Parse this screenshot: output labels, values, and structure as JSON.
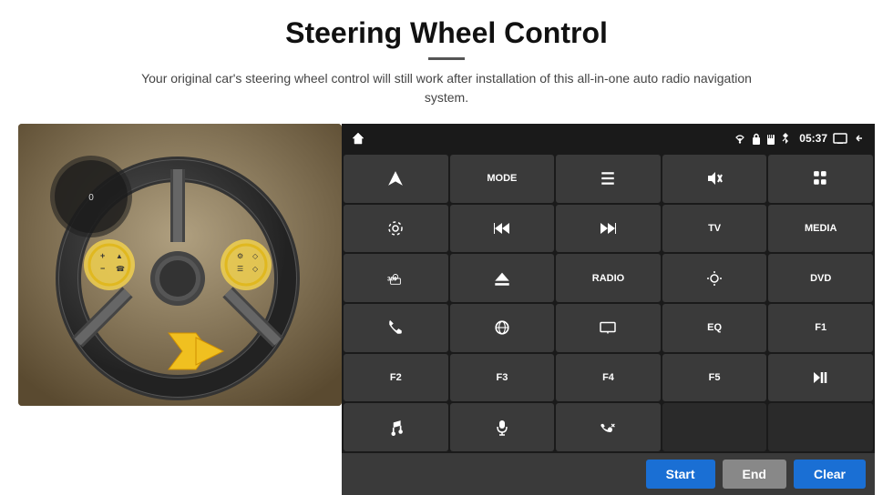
{
  "header": {
    "title": "Steering Wheel Control",
    "subtitle": "Your original car's steering wheel control will still work after installation of this all-in-one auto radio navigation system."
  },
  "statusBar": {
    "time": "05:37",
    "icons": [
      "home",
      "wifi",
      "lock",
      "sd",
      "bluetooth",
      "screen",
      "back"
    ]
  },
  "gridButtons": [
    {
      "id": "r0c0",
      "type": "icon",
      "icon": "navigate",
      "label": ""
    },
    {
      "id": "r0c1",
      "type": "text",
      "label": "MODE"
    },
    {
      "id": "r0c2",
      "type": "icon",
      "icon": "list",
      "label": ""
    },
    {
      "id": "r0c3",
      "type": "icon",
      "icon": "mute",
      "label": ""
    },
    {
      "id": "r0c4",
      "type": "icon",
      "icon": "apps",
      "label": ""
    },
    {
      "id": "r1c0",
      "type": "icon",
      "icon": "settings-o",
      "label": ""
    },
    {
      "id": "r1c1",
      "type": "icon",
      "icon": "rewind",
      "label": ""
    },
    {
      "id": "r1c2",
      "type": "icon",
      "icon": "fastforward",
      "label": ""
    },
    {
      "id": "r1c3",
      "type": "text",
      "label": "TV"
    },
    {
      "id": "r1c4",
      "type": "text",
      "label": "MEDIA"
    },
    {
      "id": "r2c0",
      "type": "icon",
      "icon": "360-cam",
      "label": ""
    },
    {
      "id": "r2c1",
      "type": "icon",
      "icon": "eject",
      "label": ""
    },
    {
      "id": "r2c2",
      "type": "text",
      "label": "RADIO"
    },
    {
      "id": "r2c3",
      "type": "icon",
      "icon": "brightness",
      "label": ""
    },
    {
      "id": "r2c4",
      "type": "text",
      "label": "DVD"
    },
    {
      "id": "r3c0",
      "type": "icon",
      "icon": "phone",
      "label": ""
    },
    {
      "id": "r3c1",
      "type": "icon",
      "icon": "browse",
      "label": ""
    },
    {
      "id": "r3c2",
      "type": "icon",
      "icon": "display",
      "label": ""
    },
    {
      "id": "r3c3",
      "type": "text",
      "label": "EQ"
    },
    {
      "id": "r3c4",
      "type": "text",
      "label": "F1"
    },
    {
      "id": "r4c0",
      "type": "text",
      "label": "F2"
    },
    {
      "id": "r4c1",
      "type": "text",
      "label": "F3"
    },
    {
      "id": "r4c2",
      "type": "text",
      "label": "F4"
    },
    {
      "id": "r4c3",
      "type": "text",
      "label": "F5"
    },
    {
      "id": "r4c4",
      "type": "icon",
      "icon": "playpause",
      "label": ""
    },
    {
      "id": "r5c0",
      "type": "icon",
      "icon": "music",
      "label": ""
    },
    {
      "id": "r5c1",
      "type": "icon",
      "icon": "mic",
      "label": ""
    },
    {
      "id": "r5c2",
      "type": "icon",
      "icon": "call-end",
      "label": ""
    },
    {
      "id": "r5c3",
      "type": "empty",
      "label": ""
    },
    {
      "id": "r5c4",
      "type": "empty",
      "label": ""
    }
  ],
  "bottomBar": {
    "startLabel": "Start",
    "endLabel": "End",
    "clearLabel": "Clear"
  }
}
